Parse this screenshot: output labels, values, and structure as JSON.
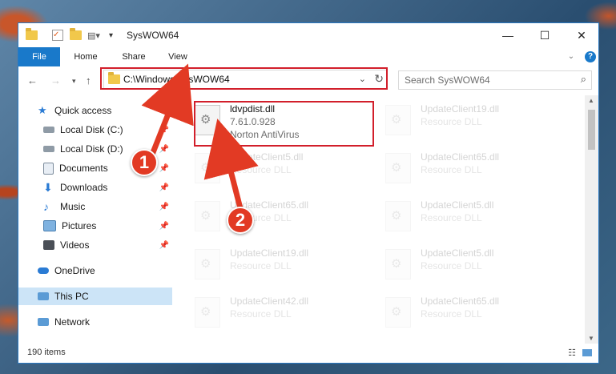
{
  "window": {
    "title": "SysWOW64",
    "controls": {
      "minimize": "—",
      "maximize": "☐",
      "close": "✕"
    }
  },
  "ribbon": {
    "tabs": [
      {
        "label": "File"
      },
      {
        "label": "Home"
      },
      {
        "label": "Share"
      },
      {
        "label": "View"
      }
    ]
  },
  "address": {
    "path": "C:\\Windows\\SysWOW64",
    "search_placeholder": "Search SysWOW64"
  },
  "nav": {
    "items": [
      {
        "label": "Quick access"
      },
      {
        "label": "Local Disk (C:)"
      },
      {
        "label": "Local Disk (D:)"
      },
      {
        "label": "Documents"
      },
      {
        "label": "Downloads"
      },
      {
        "label": "Music"
      },
      {
        "label": "Pictures"
      },
      {
        "label": "Videos"
      },
      {
        "label": "OneDrive"
      },
      {
        "label": "This PC"
      },
      {
        "label": "Network"
      }
    ]
  },
  "files": [
    {
      "name": "ldvpdist.dll",
      "line2": "7.61.0.928",
      "line3": "Norton AntiVirus"
    },
    {
      "name": "UpdateClient19.dll",
      "line2": "Resource DLL"
    },
    {
      "name": "UpdateClient5.dll",
      "line2": "Resource DLL"
    },
    {
      "name": "UpdateClient65.dll",
      "line2": "Resource DLL"
    },
    {
      "name": "UpdateClient65.dll",
      "line2": "Resource DLL"
    },
    {
      "name": "UpdateClient5.dll",
      "line2": "Resource DLL"
    },
    {
      "name": "UpdateClient19.dll",
      "line2": "Resource DLL"
    },
    {
      "name": "UpdateClient5.dll",
      "line2": "Resource DLL"
    },
    {
      "name": "UpdateClient42.dll",
      "line2": "Resource DLL"
    },
    {
      "name": "UpdateClient65.dll",
      "line2": "Resource DLL"
    }
  ],
  "status": {
    "count": "190 items"
  },
  "callouts": [
    "1",
    "2"
  ],
  "colors": {
    "accent": "#1979ca",
    "highlight": "#d21f2b",
    "callout": "#e23a24"
  }
}
